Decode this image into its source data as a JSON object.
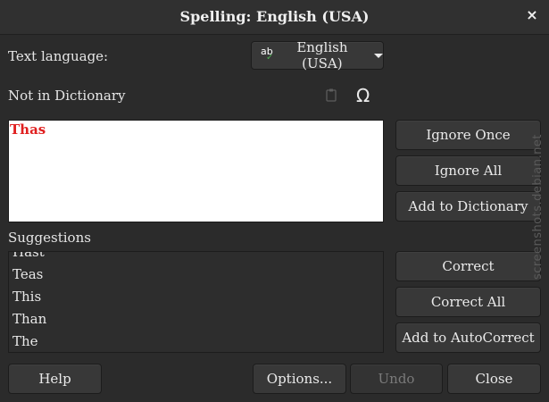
{
  "window": {
    "title": "Spelling: English (USA)",
    "close_glyph": "×"
  },
  "language": {
    "label": "Text language:",
    "selected": "English (USA)",
    "icon_text": "ab",
    "icon_check": "✓"
  },
  "not_in_dictionary": {
    "label": "Not in Dictionary",
    "word": "Thas"
  },
  "toolbar_icons": {
    "paste_icon": "paste-icon",
    "special_character_icon": "Ω"
  },
  "actions": {
    "ignore_once": "Ignore Once",
    "ignore_all": "Ignore All",
    "add_to_dictionary": "Add to Dictionary",
    "correct": "Correct",
    "correct_all": "Correct All",
    "add_to_autocorrect": "Add to AutoCorrect"
  },
  "suggestions": {
    "label": "Suggestions",
    "items": [
      "Hast",
      "Teas",
      "This",
      "Than",
      "The"
    ]
  },
  "footer": {
    "help": "Help",
    "options": "Options...",
    "undo": "Undo",
    "close": "Close"
  },
  "watermark": "screenshots.debian.net"
}
